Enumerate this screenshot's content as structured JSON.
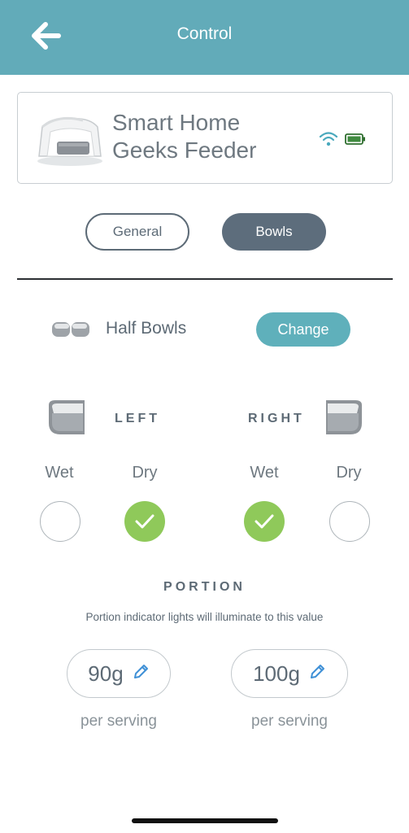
{
  "header": {
    "title": "Control"
  },
  "device": {
    "name": "Smart Home Geeks Feeder"
  },
  "segment": {
    "general_label": "General",
    "bowls_label": "Bowls"
  },
  "bowl_type": {
    "label": "Half Bowls",
    "change_label": "Change"
  },
  "left": {
    "label": "LEFT",
    "wet_label": "Wet",
    "dry_label": "Dry",
    "wet_selected": false,
    "dry_selected": true
  },
  "right": {
    "label": "RIGHT",
    "wet_label": "Wet",
    "dry_label": "Dry",
    "wet_selected": true,
    "dry_selected": false
  },
  "portion": {
    "title": "PORTION",
    "subtitle": "Portion indicator lights will illuminate to this value",
    "left_value": "90g",
    "right_value": "100g",
    "per_serving_label": "per serving"
  },
  "colors": {
    "header": "#62abb9",
    "accent": "#5fb0bb",
    "check_on": "#8fc95a",
    "segment_active": "#5d6d7c"
  },
  "icons": [
    "back-arrow-icon",
    "wifi-icon",
    "battery-icon",
    "pencil-icon",
    "check-icon"
  ]
}
